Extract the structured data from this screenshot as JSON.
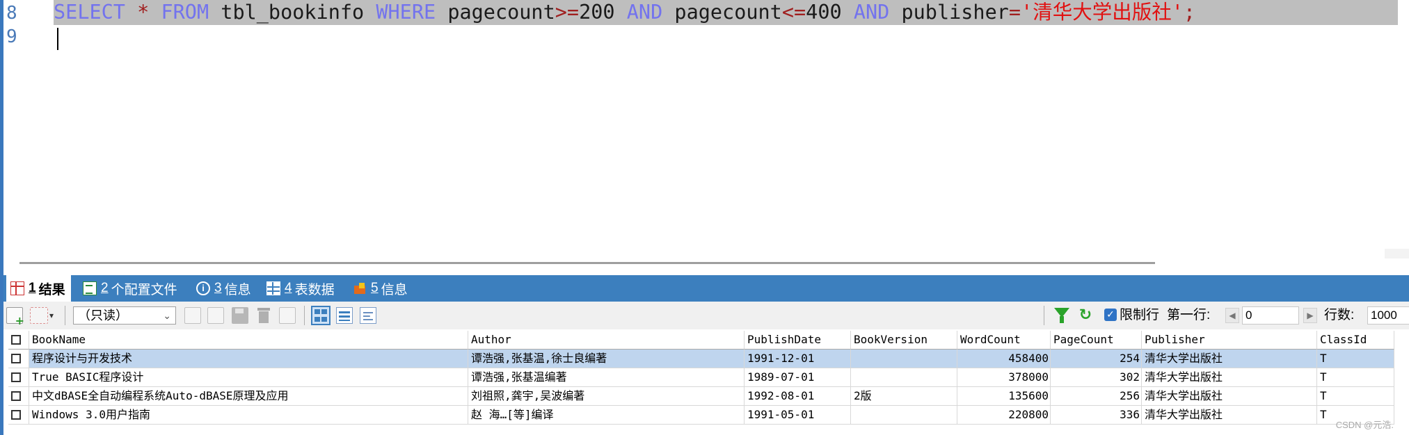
{
  "editor": {
    "line_numbers": [
      "8",
      "9"
    ],
    "sql": {
      "kw_select": "SELECT",
      "star": "*",
      "kw_from": "FROM",
      "table": "tbl_bookinfo",
      "kw_where": "WHERE",
      "col1": "pagecount",
      "op1": ">=",
      "val1": "200",
      "kw_and1": "AND",
      "col2": "pagecount",
      "op2": "<=",
      "val2": "400",
      "kw_and2": "AND",
      "col3": "publisher",
      "op3": "=",
      "val3": "'清华大学出版社'",
      "end": ";"
    }
  },
  "result_tabs": [
    {
      "num": "1",
      "label": "结果",
      "icon": "grid-icon",
      "active": true
    },
    {
      "num": "2",
      "label": "个配置文件",
      "icon": "profile-icon"
    },
    {
      "num": "3",
      "label": "信息",
      "icon": "info-icon"
    },
    {
      "num": "4",
      "label": "表数据",
      "icon": "table-icon"
    },
    {
      "num": "5",
      "label": "信息",
      "icon": "warning-icon"
    }
  ],
  "toolbar": {
    "mode_select": "（只读）",
    "limit_label": "限制行",
    "first_row_label": "第一行:",
    "first_row_value": "0",
    "row_count_label": "行数:",
    "row_count_value": "1000"
  },
  "grid": {
    "columns": [
      "BookName",
      "Author",
      "PublishDate",
      "BookVersion",
      "WordCount",
      "PageCount",
      "Publisher",
      "ClassId"
    ],
    "rows": [
      [
        "程序设计与开发技术",
        "谭浩强,张基温,徐士良编著",
        "1991-12-01",
        "",
        "458400",
        "254",
        "清华大学出版社",
        "T"
      ],
      [
        "True BASIC程序设计",
        "谭浩强,张基温编著",
        "1989-07-01",
        "",
        "378000",
        "302",
        "清华大学出版社",
        "T"
      ],
      [
        "中文dBASE全自动编程系统Auto-dBASE原理及应用",
        "刘祖照,龚宇,吴波编著",
        "1992-08-01",
        "2版",
        "135600",
        "256",
        "清华大学出版社",
        "T"
      ],
      [
        "Windows 3.0用户指南",
        "赵 海…[等]编译",
        "1991-05-01",
        "",
        "220800",
        "336",
        "清华大学出版社",
        "T"
      ]
    ]
  },
  "watermark": "CSDN @元浩.",
  "colors": {
    "keyword": "#7373ee",
    "string": "#e11010",
    "tab_bar": "#3c7fbe",
    "selected_row": "#bfd5ee"
  }
}
